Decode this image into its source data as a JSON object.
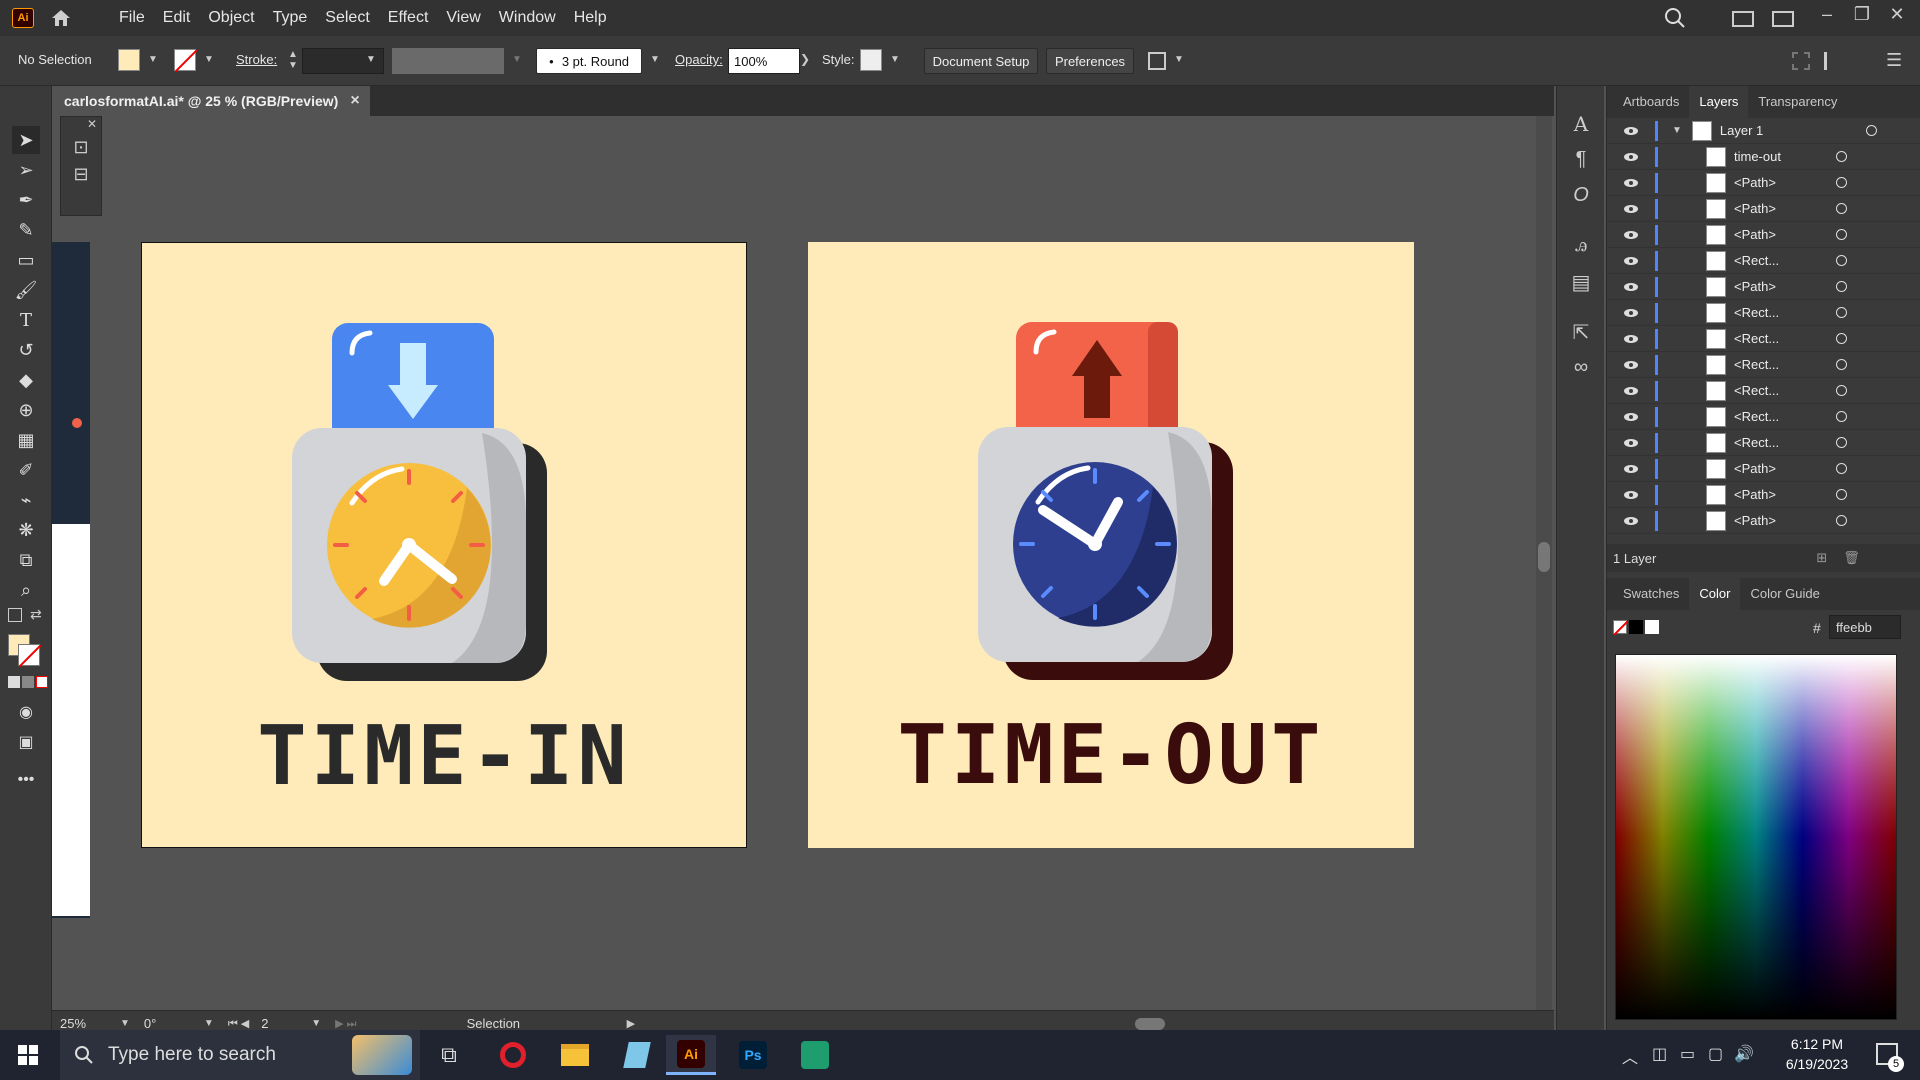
{
  "menubar": {
    "app_logo": "Ai",
    "items": [
      "File",
      "Edit",
      "Object",
      "Type",
      "Select",
      "Effect",
      "View",
      "Window",
      "Help"
    ]
  },
  "controlbar": {
    "selection": "No Selection",
    "stroke_label": "Stroke:",
    "brush": "3 pt. Round",
    "opacity_label": "Opacity:",
    "opacity_value": "100%",
    "style_label": "Style:",
    "document_setup": "Document Setup",
    "preferences": "Preferences"
  },
  "document": {
    "tab_title": "carlosformatAI.ai* @ 25 % (RGB/Preview)",
    "close": "×"
  },
  "artboards": {
    "left_text": "TIME-IN",
    "right_text": "TIME-OUT",
    "colors": {
      "background": "#ffebb9",
      "left_text": "#2a2a2a",
      "right_text": "#3a0c0c",
      "blue_card": "#4a86f0",
      "red_card": "#f2634a",
      "yellow_clock": "#f7bf3d",
      "navy_clock": "#2e3f8f"
    }
  },
  "statusbar": {
    "zoom": "25%",
    "rotation": "0°",
    "artboard_num": "2",
    "tool": "Selection"
  },
  "layers_panel": {
    "tabs": [
      "Artboards",
      "Layers",
      "Transparency"
    ],
    "active_tab": "Layers",
    "layer_name": "Layer 1",
    "items": [
      "time-out",
      "<Path>",
      "<Path>",
      "<Path>",
      "<Rect...",
      "<Path>",
      "<Rect...",
      "<Rect...",
      "<Rect...",
      "<Rect...",
      "<Rect...",
      "<Rect...",
      "<Path>",
      "<Path>",
      "<Path>"
    ],
    "footer": "1 Layer"
  },
  "color_panel": {
    "tabs": [
      "Swatches",
      "Color",
      "Color Guide"
    ],
    "active_tab": "Color",
    "hash": "#",
    "hex_value": "ffeebb"
  },
  "taskbar": {
    "search_placeholder": "Type here to search",
    "time": "6:12 PM",
    "date": "6/19/2023",
    "notification_count": "5",
    "apps": [
      "Opera",
      "File Explorer",
      "Notepad",
      "Illustrator",
      "Photoshop",
      "Inkscape"
    ],
    "ai_label": "Ai",
    "ps_label": "Ps"
  }
}
